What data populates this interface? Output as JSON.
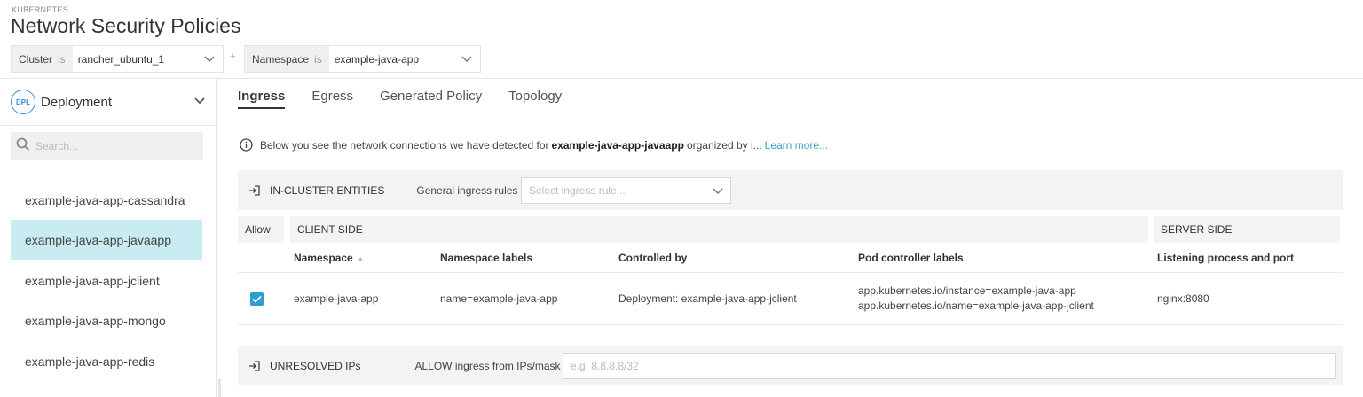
{
  "header": {
    "eyebrow": "KUBERNETES",
    "title": "Network Security Policies",
    "filters": [
      {
        "label": "Cluster",
        "op": "is",
        "value": "rancher_ubuntu_1"
      },
      {
        "label": "Namespace",
        "op": "is",
        "value": "example-java-app"
      }
    ],
    "plus": "+"
  },
  "sidebar": {
    "type_badge": "DPL",
    "type_label": "Deployment",
    "search_placeholder": "Search...",
    "items": [
      {
        "label": "example-java-app-cassandra",
        "active": false
      },
      {
        "label": "example-java-app-javaapp",
        "active": true
      },
      {
        "label": "example-java-app-jclient",
        "active": false
      },
      {
        "label": "example-java-app-mongo",
        "active": false
      },
      {
        "label": "example-java-app-redis",
        "active": false
      }
    ]
  },
  "tabs": [
    {
      "label": "Ingress",
      "active": true
    },
    {
      "label": "Egress",
      "active": false
    },
    {
      "label": "Generated Policy",
      "active": false
    },
    {
      "label": "Topology",
      "active": false
    }
  ],
  "info": {
    "prefix": "Below you see the network connections we have detected for",
    "entity": "example-java-app-javaapp",
    "suffix": "organized by i...",
    "link": "Learn more..."
  },
  "in_cluster": {
    "title": "IN-CLUSTER ENTITIES",
    "rules_label": "General ingress rules",
    "rules_placeholder": "Select ingress rule..."
  },
  "table": {
    "allow_header": "Allow",
    "client_header": "CLIENT SIDE",
    "server_header": "SERVER SIDE",
    "columns": [
      "Namespace",
      "Namespace labels",
      "Controlled by",
      "Pod controller labels",
      "Listening process and port"
    ],
    "sort_indicator": "▲",
    "rows": [
      {
        "allowed": true,
        "namespace": "example-java-app",
        "namespace_labels": "name=example-java-app",
        "controlled_by": "Deployment: example-java-app-jclient",
        "pod_labels_1": "app.kubernetes.io/instance=example-java-app",
        "pod_labels_2": "app.kubernetes.io/name=example-java-app-jclient",
        "process_port": "nginx:8080"
      }
    ]
  },
  "unresolved": {
    "title": "UNRESOLVED IPs",
    "label": "ALLOW ingress from IPs/mask",
    "placeholder": "e.g. 8.8.8.8/32"
  },
  "colors": {
    "accent": "#2b9fd0",
    "active_row": "#c9ecf2",
    "link": "#34a2c4",
    "panel": "#f2f3f4"
  }
}
